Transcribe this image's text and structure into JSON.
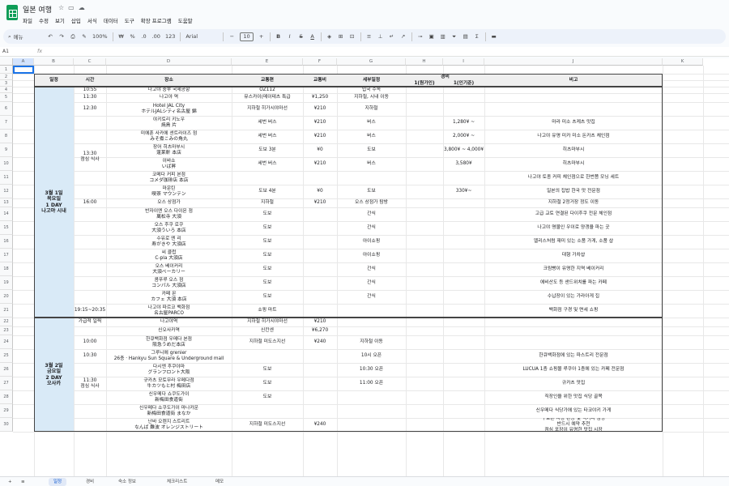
{
  "app": {
    "title": "일본 여행",
    "menu": [
      "파일",
      "수정",
      "보기",
      "삽입",
      "서식",
      "데이터",
      "도구",
      "확장 프로그램",
      "도움말"
    ],
    "title_icons": [
      "star-icon",
      "folder-icon",
      "cloud-icon"
    ]
  },
  "toolbar": {
    "search_label": "메뉴",
    "zoom": "100%",
    "currency": "₩",
    "percent": "%",
    "decimal_less": ".0",
    "decimal_more": ".00",
    "number_format": "123",
    "font": "Arial",
    "minus": "−",
    "font_size": "10",
    "plus": "+",
    "bold": "B",
    "italic": "I",
    "strike": "S",
    "text_color": "A"
  },
  "formula": {
    "namebox": "A1",
    "fx": "fx",
    "value": ""
  },
  "columns": [
    "A",
    "B",
    "C",
    "D",
    "E",
    "F",
    "G",
    "H",
    "I",
    "J",
    "K"
  ],
  "rows": [
    {
      "n": "1",
      "h": 10
    },
    {
      "n": "2",
      "h": 8
    },
    {
      "n": "3",
      "h": 8
    },
    {
      "n": "4",
      "h": 8
    },
    {
      "n": "5",
      "h": 11
    },
    {
      "n": "6",
      "h": 17
    },
    {
      "n": "7",
      "h": 17
    },
    {
      "n": "8",
      "h": 17
    },
    {
      "n": "9",
      "h": 17
    },
    {
      "n": "10",
      "h": 17
    },
    {
      "n": "11",
      "h": 17
    },
    {
      "n": "12",
      "h": 17
    },
    {
      "n": "13",
      "h": 11
    },
    {
      "n": "14",
      "h": 17
    },
    {
      "n": "15",
      "h": 17
    },
    {
      "n": "16",
      "h": 17
    },
    {
      "n": "17",
      "h": 17
    },
    {
      "n": "18",
      "h": 17
    },
    {
      "n": "19",
      "h": 17
    },
    {
      "n": "20",
      "h": 17
    },
    {
      "n": "21",
      "h": 17
    },
    {
      "n": "22",
      "h": 11
    },
    {
      "n": "23",
      "h": 11
    },
    {
      "n": "24",
      "h": 17
    },
    {
      "n": "25",
      "h": 17
    },
    {
      "n": "26",
      "h": 17
    },
    {
      "n": "27",
      "h": 17
    },
    {
      "n": "28",
      "h": 17
    },
    {
      "n": "29",
      "h": 17
    },
    {
      "n": "30",
      "h": 17
    }
  ],
  "header": {
    "date": "일정",
    "time": "시간",
    "place": "장소",
    "transport": "교통편",
    "fare": "교통비",
    "detail": "세부일정",
    "cost": "경비",
    "cost_a": "1(원가인)",
    "cost_b": "1(인기준)",
    "note": "비고"
  },
  "day1": {
    "line1": "3월 1일",
    "line2": "목요일",
    "line3": "1 DAY",
    "line4": "나고야 시내"
  },
  "day2": {
    "line1": "3월 2일",
    "line2": "금요일",
    "line3": "2 DAY",
    "line4": "오사카"
  },
  "day1_times": {
    "t1": "10:55",
    "t2": "11:30",
    "t3": "12:30",
    "t4": "13:30",
    "t4b": "점심 식사",
    "t5": "16:00",
    "t6": "19:15~20:35"
  },
  "day2_times": {
    "t0": "가급적 일찍",
    "t1": "10:00",
    "t2": "10:30",
    "t3": "11:30",
    "t3b": "점심 식사"
  },
  "day1_rows": [
    {
      "place": "나고야 중부 국제공항",
      "transport": "OZ112",
      "fare": "",
      "detail": "입국 수속",
      "cost": "",
      "note": ""
    },
    {
      "place": "나고야 역",
      "transport": "뮤스카이(메이테츠 특급",
      "fare": "¥1,250",
      "detail": "지하철, 시내 이동",
      "cost": "",
      "note": ""
    },
    {
      "place": "Hotel JAL City",
      "place2": "ホテルJALシティ名古屋 錦",
      "transport": "지하철 히가시야마선",
      "fare": "¥210",
      "detail": "지하철",
      "cost": "",
      "note": ""
    },
    {
      "place": "야키토리 키노우",
      "place2": "焼鳥 片",
      "transport": "세번 버스",
      "fare": "¥210",
      "detail": "버스",
      "cost": "1,280¥ ~",
      "note": "마라 미소 츠케츠 맛집"
    },
    {
      "place": "미에훈 사카에 센트라이즈 점",
      "place2": "みそ煮こみの角丸",
      "transport": "세번 버스",
      "fare": "¥210",
      "detail": "버스",
      "cost": "2,000¥ ~",
      "note": "나고야 유명 미카 미소 돈카츠 체인점"
    },
    {
      "place": "장어 히츠마부시",
      "place2": "蓬莱軒 本店",
      "transport": "도보 3분",
      "fare": "¥0",
      "detail": "도보",
      "cost": "3,800¥ ~ 4,000¥",
      "note": "히츠마부시"
    },
    {
      "place": "이바쇼",
      "place2": "いば昇",
      "transport": "세번 버스",
      "fare": "¥210",
      "detail": "버스",
      "cost": "3,580¥",
      "note": "히츠마부시"
    },
    {
      "place": "코메다 커피 본점",
      "place2": "コメダ珈琲店 本店",
      "transport": "",
      "fare": "",
      "detail": "",
      "cost": "",
      "note": "나고야 토종 커피 체인점으로 한번쯤 모닝 세트"
    },
    {
      "place": "마운틴",
      "place2": "喫茶 マウンテン",
      "transport": "도보 4분",
      "fare": "¥0",
      "detail": "도보",
      "cost": "330¥~",
      "note": "일본의 집밥 한국 맛 전문점"
    },
    {
      "place": "오스 상점가",
      "transport": "지하철",
      "fare": "¥210",
      "detail": "오스 상점가 탐방",
      "cost": "",
      "note": "지하철 2정거장 정도 이동"
    },
    {
      "place": "반자이엔 오스 다이몬 점",
      "place2": "萬松寺 大須",
      "transport": "도보",
      "fare": "",
      "detail": "간식",
      "cost": "",
      "note": "고급 교토 연결된 다이후쿠 전문 체인점"
    },
    {
      "place": "오스 후쿠 로쿠",
      "place2": "大須ういろ 本店",
      "transport": "도보",
      "fare": "",
      "detail": "간식",
      "cost": "",
      "note": "나고야 명물인 우이로 양갱을 파는 곳"
    },
    {
      "place": "수유로 엔 리",
      "place2": "寿がきや 大須店",
      "transport": "도보",
      "fare": "",
      "detail": "아이쇼핑",
      "cost": "",
      "note": "엘리스처럼 재미 있는 소품 가게, 소품 샵"
    },
    {
      "place": "씨 클럽",
      "place2": "C-pla 大須店",
      "transport": "도보",
      "fare": "",
      "detail": "아이쇼핑",
      "cost": "",
      "note": "대형 가차샵"
    },
    {
      "place": "오스 베이커리",
      "place2": "大須ベーカリー",
      "transport": "도보",
      "fare": "",
      "detail": "간식",
      "cost": "",
      "note": "크림빵이 유명한 지역 베이커리"
    },
    {
      "place": "콤푸루 오스 점",
      "place2": "コンパル 大須店",
      "transport": "도보",
      "fare": "",
      "detail": "간식",
      "cost": "",
      "note": "에비산도 등 샌드위치를 파는 카페"
    },
    {
      "place": "카페 몬",
      "place2": "カフェ 大須 本店",
      "transport": "도보",
      "fare": "",
      "detail": "간식",
      "cost": "",
      "note": "수납장이 있는 가라아게 집"
    },
    {
      "place": "나고야 파르코 백화점",
      "place2": "名古屋PARCO",
      "transport": "쇼핑 마트",
      "fare": "",
      "detail": "",
      "cost": "",
      "note": "백화점 구경 및 면세 쇼핑"
    }
  ],
  "day2_rows": [
    {
      "place": "나고야역",
      "transport": "지하철 히가시야마선",
      "fare": "¥210",
      "detail": "",
      "cost": "",
      "note": ""
    },
    {
      "place": "신오사카역",
      "transport": "신칸센",
      "fare": "¥6,270",
      "detail": "",
      "cost": "",
      "note": ""
    },
    {
      "place": "한큐백화점 우메다 본점",
      "place2": "阪急うめだ本店",
      "transport": "지하철 미도스지선",
      "fare": "¥240",
      "detail": "지하철 이동",
      "cost": "",
      "note": ""
    },
    {
      "place": "그루니에 grenier",
      "place2": "26층 · Hankyu Sun Square & Underground mall",
      "transport": "",
      "fare": "",
      "detail": "10시 오픈",
      "cost": "",
      "note": "한큐백화점에 있는 파스트리 전문점"
    },
    {
      "place": "다시엔 후쿠야마",
      "place2": "グランフロント大阪",
      "transport": "도보",
      "fare": "",
      "detail": "10:30 오픈",
      "cost": "",
      "note": "LUCUA 1층 쇼핑몰 루쿠아 1층에 있는 카페 전문점"
    },
    {
      "place": "규카츠 모토무라 우메다점",
      "place2": "牛カツもと村 梅田店",
      "transport": "도보",
      "fare": "",
      "detail": "11:00 오픈",
      "cost": "",
      "note": "규카츠 맛집"
    },
    {
      "place": "신우메다 쇼쿠도가이",
      "place2": "新梅田食道街",
      "transport": "도보",
      "fare": "",
      "detail": "",
      "cost": "",
      "note": "직장인을 위한 맛집 식당 골목"
    },
    {
      "place": "신우메다 쇼쿠도가이 마나카운",
      "place2": "新梅田食道街 まなか",
      "transport": "",
      "fare": "",
      "detail": "",
      "cost": "",
      "note": "신우메다 식당가에 있는 타코야키 가게"
    },
    {
      "place": "난바 오렌지 스트리트",
      "place2": "なんば 難波 オレンジストリート",
      "transport": "지하철 미도스지선",
      "fare": "¥240",
      "detail": "",
      "cost": "",
      "note": "구로몬 시장 관광 및 먹거리 탐방"
    }
  ],
  "day2_note_extra": {
    "a": "반드시 예약 추천",
    "b": "점심 포장이 유명한 맛집 시장"
  },
  "sheets": [
    "일정",
    "경비",
    "숙소 정보",
    "체크리스트",
    "메모"
  ],
  "colors": {
    "accent": "#1a73e8",
    "sheets_green": "#0f9d58",
    "date_bg": "#d9eaf7",
    "header_bg": "#efefef"
  }
}
